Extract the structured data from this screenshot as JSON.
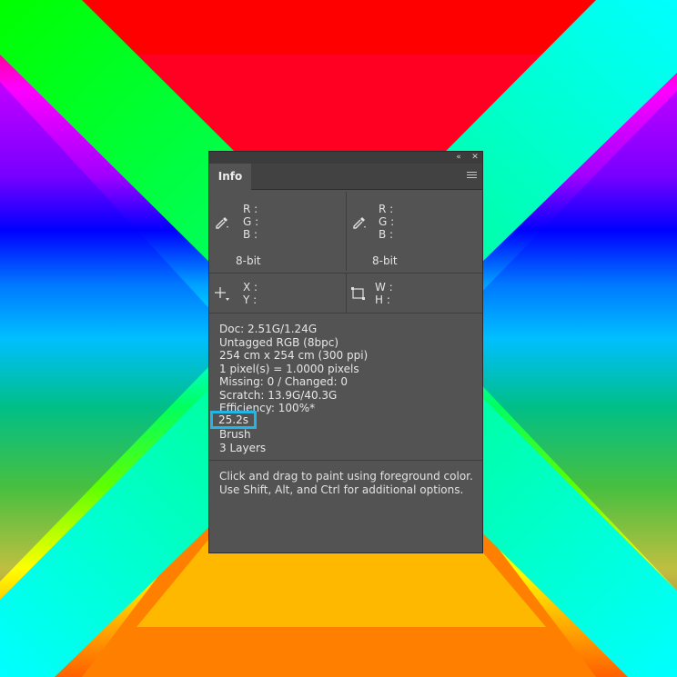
{
  "panel": {
    "tab_label": "Info",
    "color_left": {
      "r_label": "R :",
      "g_label": "G :",
      "b_label": "B :",
      "mode": "8-bit"
    },
    "color_right": {
      "r_label": "R :",
      "g_label": "G :",
      "b_label": "B :",
      "mode": "8-bit"
    },
    "position": {
      "x_label": "X :",
      "y_label": "Y :"
    },
    "size": {
      "w_label": "W :",
      "h_label": "H :"
    },
    "doc_info": [
      "Doc: 2.51G/1.24G",
      "Untagged RGB (8bpc)",
      "254 cm x 254 cm (300 ppi)",
      "1 pixel(s) = 1.0000 pixels",
      "Missing: 0 / Changed: 0",
      "Scratch: 13.9G/40.3G",
      "Efficiency: 100%*"
    ],
    "timing": "25.2s",
    "tool": "Brush",
    "layers": "3 Layers",
    "hint": [
      "Click and drag to paint using foreground color.",
      "Use Shift, Alt, and Ctrl for additional options."
    ]
  },
  "icons": {
    "collapse": "double-chevron-left-icon",
    "close": "close-icon",
    "menu": "panel-menu-icon",
    "eyedropper": "eyedropper-icon",
    "crosshair": "crosshair-icon",
    "selection": "selection-size-icon"
  },
  "colors": {
    "highlight_border": "#22b6e6",
    "panel_bg": "#535353"
  }
}
